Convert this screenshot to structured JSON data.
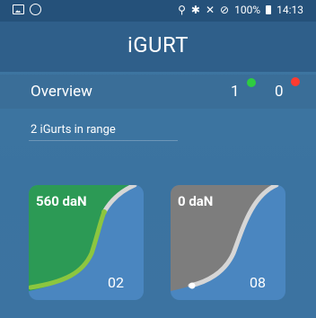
{
  "status_bar": {
    "battery": "100%",
    "time": "14:13"
  },
  "app": {
    "title": "iGURT"
  },
  "overview": {
    "label": "Overview",
    "green_count": "1",
    "red_count": "0"
  },
  "in_range_text": "2 iGurts in range",
  "cards": [
    {
      "force": "560 daN",
      "number": "02",
      "active_color": "#2c9a55",
      "level": 0.75
    },
    {
      "force": "0 daN",
      "number": "08",
      "active_color": "#7d7d7d",
      "level": 0.0
    }
  ],
  "colors": {
    "status_bar": "#25517a",
    "app_bar": "#2f5f8a",
    "card_bg": "#4a86c0",
    "curve_active": "#8cc63f",
    "curve_inactive": "#d6d6d6",
    "green_dot": "#2ecc40",
    "red_dot": "#ff3b30"
  }
}
